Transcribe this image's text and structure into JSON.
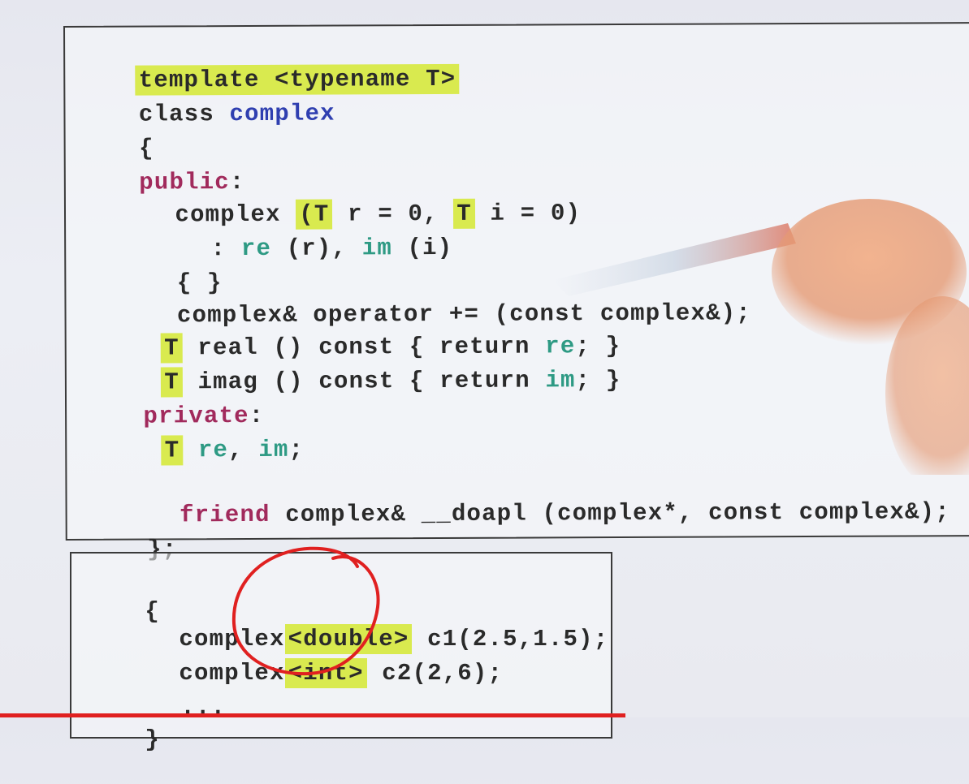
{
  "class_code": {
    "line1": "template <typename T>",
    "line2_kw": "class",
    "line2_name": "complex",
    "line3": "{",
    "line4_kw": "public",
    "line4_colon": ":",
    "line5_a": "complex ",
    "line5_t1": "(T",
    "line5_b": " r = 0, ",
    "line5_t2": "T",
    "line5_c": " i = 0)",
    "line6_a": ": ",
    "line6_re": "re",
    "line6_b": " (r), ",
    "line6_im": "im",
    "line6_c": " (i)",
    "line7": "{ }",
    "line8": "complex& operator += (const complex&);",
    "line9_t": "T",
    "line9_a": " real () const { return ",
    "line9_re": "re",
    "line9_b": "; }",
    "line10_t": "T",
    "line10_a": " imag () const { return ",
    "line10_im": "im",
    "line10_b": "; }",
    "line11_kw": "private",
    "line11_colon": ":",
    "line12_t": "T",
    "line12_re": " re",
    "line12_comma": ", ",
    "line12_im": "im",
    "line12_semi": ";",
    "line13_kw": "friend",
    "line13_rest": " complex& __doapl (complex*, const complex&);",
    "line14": "};"
  },
  "usage_code": {
    "line1": "{",
    "line2_a": "complex",
    "line2_hl": "<double>",
    "line2_b": " c1(2.5,1.5);",
    "line3_a": "complex",
    "line3_hl": "<int>",
    "line3_b": " c2(2,6);",
    "line4": "...",
    "line5": "}"
  },
  "colors": {
    "highlight": "#d9ea4f",
    "keyword_blue": "#2f3fb0",
    "keyword_purple": "#a12a5c",
    "member_teal": "#2e9a84",
    "annotation_red": "#e02020"
  }
}
